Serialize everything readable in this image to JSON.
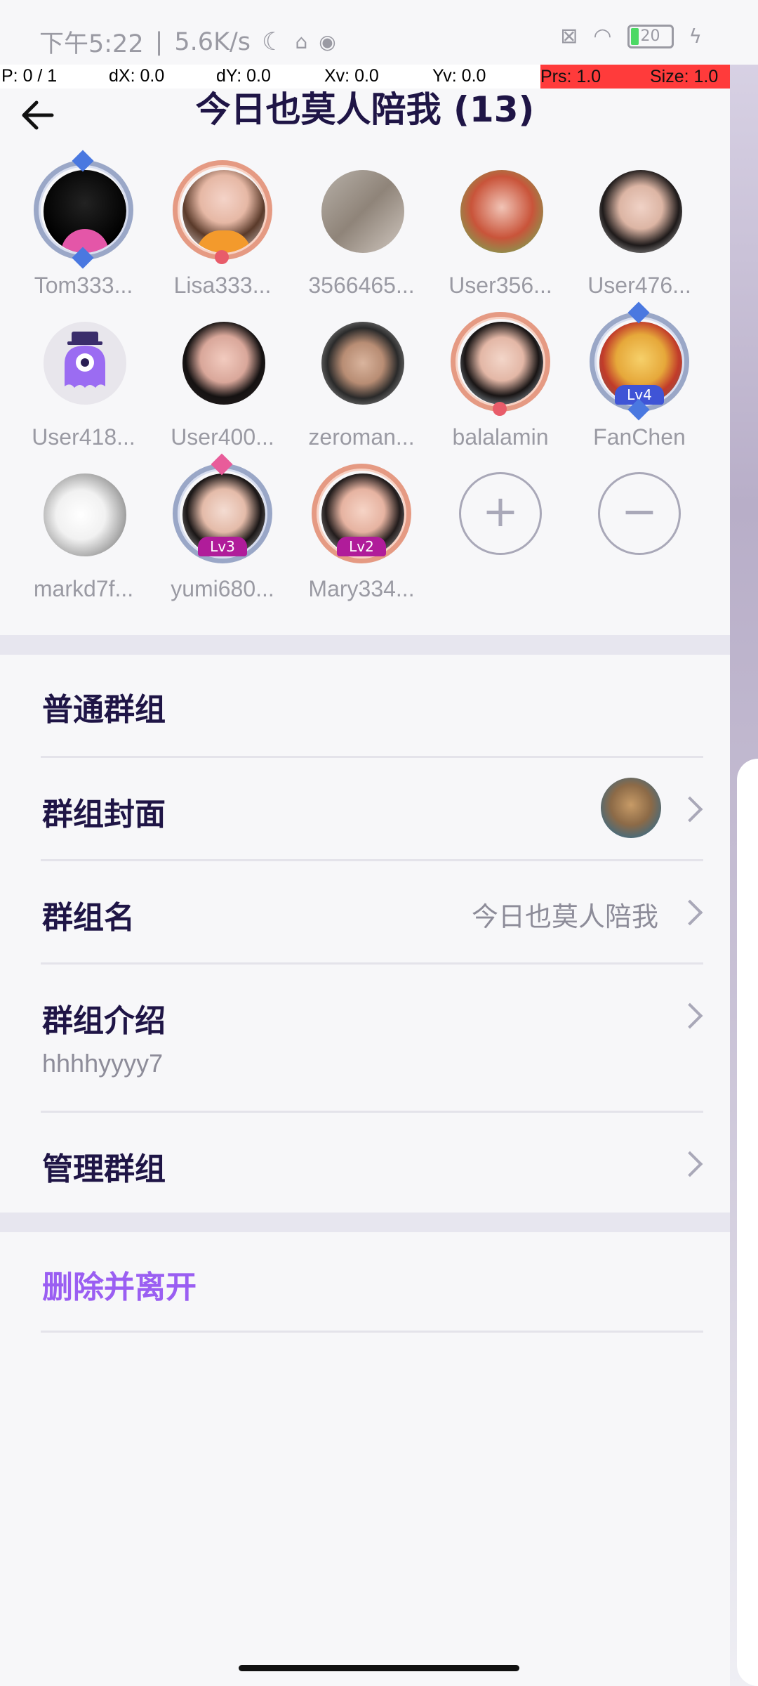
{
  "status_bar": {
    "time": "下午5:22",
    "speed": "5.6K/s",
    "separator": "|",
    "battery": "20"
  },
  "debug_bar": {
    "p": "P: 0 / 1",
    "dx": "dX: 0.0",
    "dy": "dY: 0.0",
    "xv": "Xv: 0.0",
    "yv": "Yv: 0.0",
    "prs": "Prs: 1.0",
    "size": "Size: 1.0"
  },
  "header": {
    "title": "今日也莫人陪我 (13)"
  },
  "members": [
    {
      "name": "Tom333..."
    },
    {
      "name": "Lisa333..."
    },
    {
      "name": "3566465..."
    },
    {
      "name": "User356..."
    },
    {
      "name": "User476..."
    },
    {
      "name": "User418..."
    },
    {
      "name": "User400..."
    },
    {
      "name": "zeroman..."
    },
    {
      "name": "balalamin"
    },
    {
      "name": "FanChen",
      "level": "Lv4"
    },
    {
      "name": "markd7f..."
    },
    {
      "name": "yumi680...",
      "level": "Lv3"
    },
    {
      "name": "Mary334...",
      "level": "Lv2"
    }
  ],
  "actions": {
    "add": "+",
    "remove": "−"
  },
  "settings": {
    "group_type": "普通群组",
    "cover_label": "群组封面",
    "name_label": "群组名",
    "name_value": "今日也莫人陪我",
    "intro_label": "群组介绍",
    "intro_value": "hhhhyyyy7",
    "manage_label": "管理群组",
    "leave_label": "删除并离开"
  },
  "colors": {
    "title": "#1f1546",
    "danger": "#9a5ef2",
    "muted": "#8d8c99"
  }
}
